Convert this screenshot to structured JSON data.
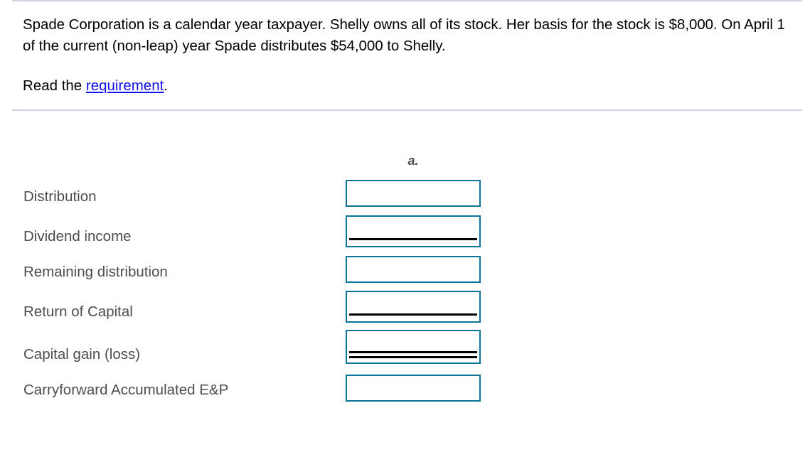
{
  "problem": {
    "statement": "Spade Corporation is a calendar year taxpayer. Shelly owns all of its stock. Her basis for the stock is $8,000. On April 1 of the current (non-leap) year Spade distributes $54,000 to Shelly.",
    "read_prefix": "Read the ",
    "requirement_link": "requirement",
    "read_suffix": "."
  },
  "worksheet": {
    "column_header": "a.",
    "rows": [
      {
        "label": "Distribution",
        "value": "",
        "placeholder": "",
        "underline": "none"
      },
      {
        "label": "Dividend income",
        "value": "",
        "placeholder": "",
        "underline": "single"
      },
      {
        "label": "Remaining distribution",
        "value": "",
        "placeholder": "",
        "underline": "none"
      },
      {
        "label": "Return of Capital",
        "value": "",
        "placeholder": "",
        "underline": "single"
      },
      {
        "label": "Capital gain (loss)",
        "value": "",
        "placeholder": "",
        "underline": "double"
      },
      {
        "label": "Carryforward Accumulated E&P",
        "value": "",
        "placeholder": "",
        "underline": "none"
      }
    ]
  },
  "colors": {
    "box_border": "#0b7595",
    "link": "#1111ee",
    "label_text": "#4d4d4d",
    "divider": "#cfd3df",
    "rule": "#000000"
  }
}
